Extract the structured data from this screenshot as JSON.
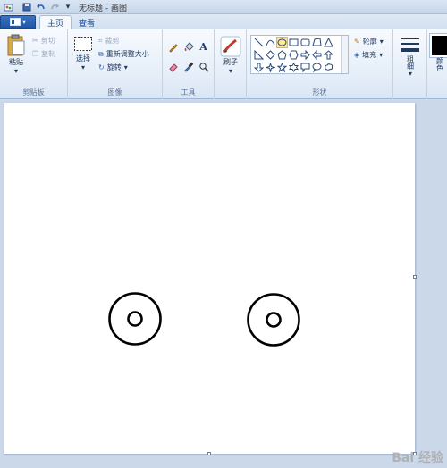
{
  "window": {
    "title": "无标题 - 画图"
  },
  "quick_access": {
    "icons": [
      "paint-app-icon",
      "save-icon",
      "undo-icon",
      "redo-icon",
      "customize-arrow-icon"
    ]
  },
  "tabs": {
    "file_label": "",
    "items": [
      {
        "label": "主页",
        "active": true
      },
      {
        "label": "查看",
        "active": false
      }
    ]
  },
  "clipboard": {
    "paste_label": "粘贴",
    "cut_label": "剪切",
    "copy_label": "复制",
    "group_label": "剪贴板"
  },
  "image": {
    "select_label": "选择",
    "crop_label": "裁剪",
    "resize_label": "重新调整大小",
    "rotate_label": "旋转",
    "group_label": "图像"
  },
  "tools": {
    "group_label": "工具"
  },
  "brushes": {
    "label": "刷子"
  },
  "shapes": {
    "outline_label": "轮廓",
    "fill_label": "填充",
    "group_label": "形状"
  },
  "size": {
    "label": "粗细"
  },
  "colors": {
    "color1_label": "颜色",
    "color1_value": "#000000"
  },
  "watermark": {
    "text": "Bai 经验"
  }
}
